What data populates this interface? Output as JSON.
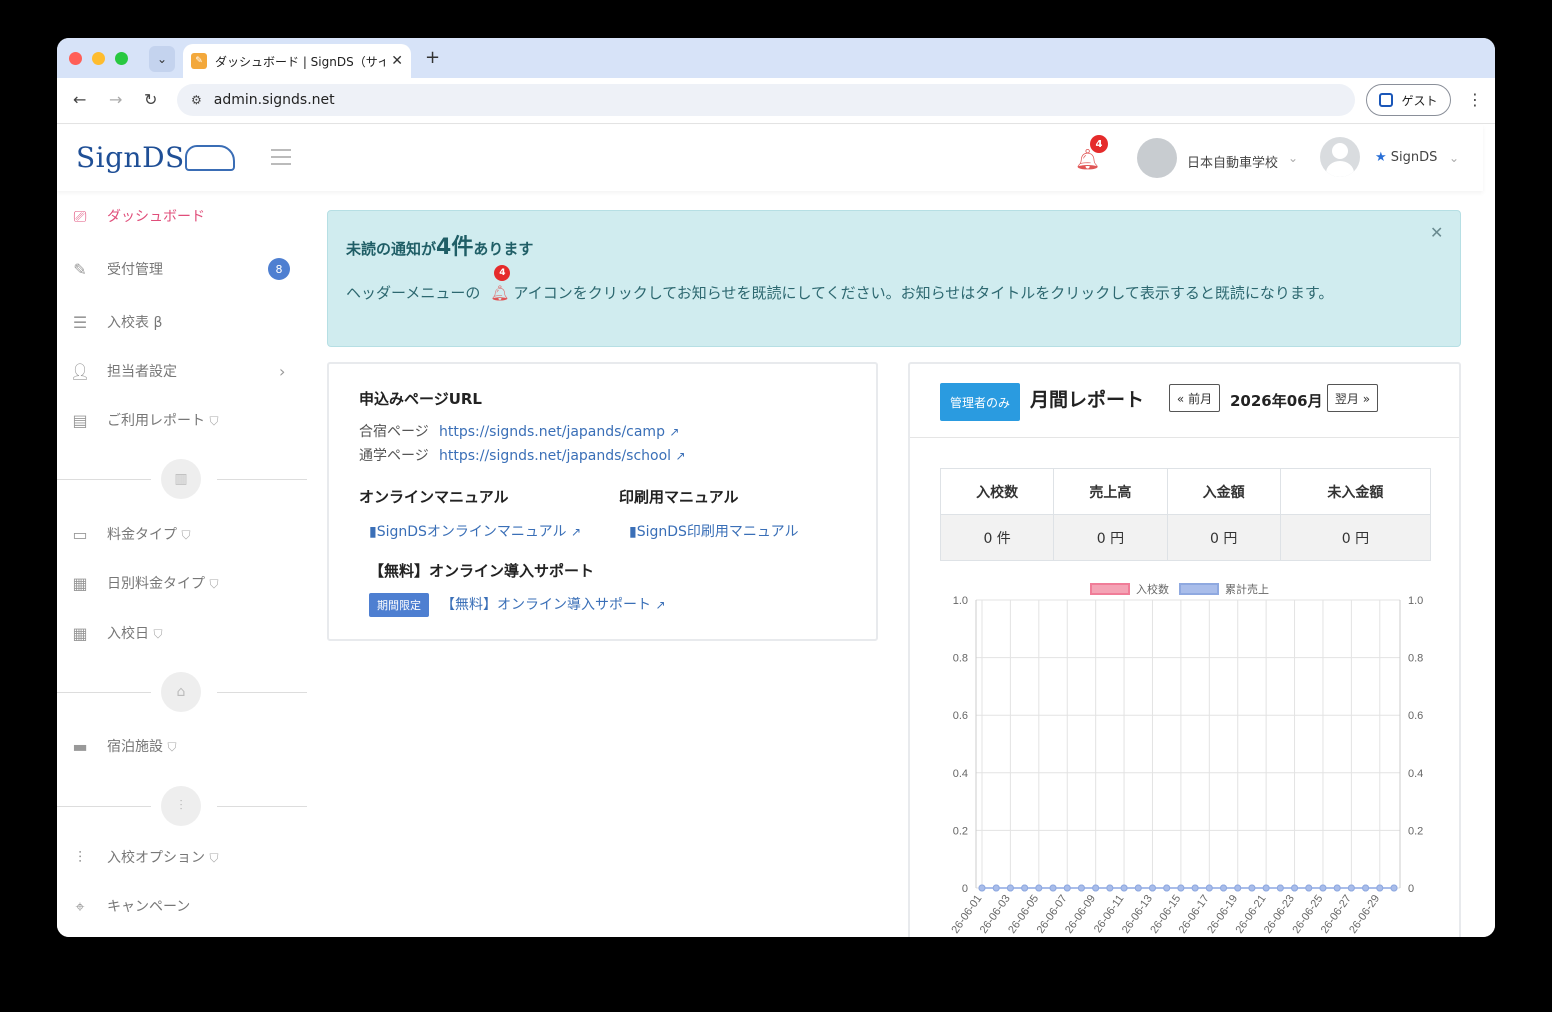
{
  "browser": {
    "tab_title": "ダッシュボード | SignDS（サイ",
    "url": "admin.signds.net",
    "guest_label": "ゲスト"
  },
  "header": {
    "logo": "SignDS",
    "bell_count": "4",
    "school_name": "日本自動車学校",
    "user_name": "SignDS"
  },
  "sidebar": {
    "items": [
      {
        "label": "ダッシュボード",
        "icon": "presentation-icon"
      },
      {
        "label": "受付管理",
        "icon": "edit-icon",
        "badge": "8"
      },
      {
        "label": "入校表 β",
        "icon": "list-icon"
      },
      {
        "label": "担当者設定",
        "icon": "user-icon"
      },
      {
        "label": "ご利用レポート",
        "icon": "report-icon"
      },
      {
        "label": "料金タイプ",
        "icon": "money-icon"
      },
      {
        "label": "日別料金タイプ",
        "icon": "table-icon"
      },
      {
        "label": "入校日",
        "icon": "calendar-icon"
      },
      {
        "label": "宿泊施設",
        "icon": "hotel-icon"
      },
      {
        "label": "入校オプション",
        "icon": "sliders-icon"
      },
      {
        "label": "キャンペーン",
        "icon": "tag-icon"
      }
    ]
  },
  "alert": {
    "title_prefix": "未読の通知が",
    "count": "4件",
    "title_suffix": "あります",
    "body_prefix": "ヘッダーメニューの",
    "bell_count": "4",
    "body_suffix": "アイコンをクリックしてお知らせを既読にしてください。お知らせはタイトルをクリックして表示すると既読になります。"
  },
  "left_card": {
    "url_heading": "申込みページURL",
    "camp_label": "合宿ページ",
    "camp_url": "https://signds.net/japands/camp",
    "school_label": "通学ページ",
    "school_url": "https://signds.net/japands/school",
    "online_manual_heading": "オンラインマニュアル",
    "online_manual_link": "SignDSオンラインマニュアル",
    "print_manual_heading": "印刷用マニュアル",
    "print_manual_link": "SignDS印刷用マニュアル",
    "support_heading": "【無料】オンライン導入サポート",
    "support_badge": "期間限定",
    "support_link": "【無料】オンライン導入サポート"
  },
  "report": {
    "admin_badge": "管理者のみ",
    "title": "月間レポート",
    "prev": "« 前月",
    "month": "2026年06月",
    "next": "翌月 »",
    "headers": [
      "入校数",
      "売上高",
      "入金額",
      "未入金額"
    ],
    "values": [
      "0 件",
      "0 円",
      "0 円",
      "0 円"
    ],
    "legend": [
      "入校数",
      "累計売上"
    ]
  },
  "chart_data": {
    "type": "line",
    "x": [
      "2026-06-01",
      "2026-06-02",
      "2026-06-03",
      "2026-06-04",
      "2026-06-05",
      "2026-06-06",
      "2026-06-07",
      "2026-06-08",
      "2026-06-09",
      "2026-06-10",
      "2026-06-11",
      "2026-06-12",
      "2026-06-13",
      "2026-06-14",
      "2026-06-15",
      "2026-06-16",
      "2026-06-17",
      "2026-06-18",
      "2026-06-19",
      "2026-06-20",
      "2026-06-21",
      "2026-06-22",
      "2026-06-23",
      "2026-06-24",
      "2026-06-25",
      "2026-06-26",
      "2026-06-27",
      "2026-06-28",
      "2026-06-29",
      "2026-06-30"
    ],
    "x_tick_labels": [
      "26-06-01",
      "26-06-03",
      "26-06-05",
      "26-06-07",
      "26-06-09",
      "26-06-11",
      "26-06-13",
      "26-06-15",
      "26-06-17",
      "26-06-19",
      "26-06-21",
      "26-06-23",
      "26-06-25",
      "26-06-27",
      "26-06-29"
    ],
    "series": [
      {
        "name": "入校数",
        "color": "#f4a3b5",
        "values": [
          0,
          0,
          0,
          0,
          0,
          0,
          0,
          0,
          0,
          0,
          0,
          0,
          0,
          0,
          0,
          0,
          0,
          0,
          0,
          0,
          0,
          0,
          0,
          0,
          0,
          0,
          0,
          0,
          0,
          0
        ]
      },
      {
        "name": "累計売上",
        "color": "#a9bdea",
        "values": [
          0,
          0,
          0,
          0,
          0,
          0,
          0,
          0,
          0,
          0,
          0,
          0,
          0,
          0,
          0,
          0,
          0,
          0,
          0,
          0,
          0,
          0,
          0,
          0,
          0,
          0,
          0,
          0,
          0,
          0
        ]
      }
    ],
    "y_ticks": [
      "1.0",
      "0.8",
      "0.6",
      "0.4",
      "0.2",
      "0"
    ],
    "ylim": [
      0,
      1
    ],
    "grid": true,
    "legend_position": "top"
  }
}
